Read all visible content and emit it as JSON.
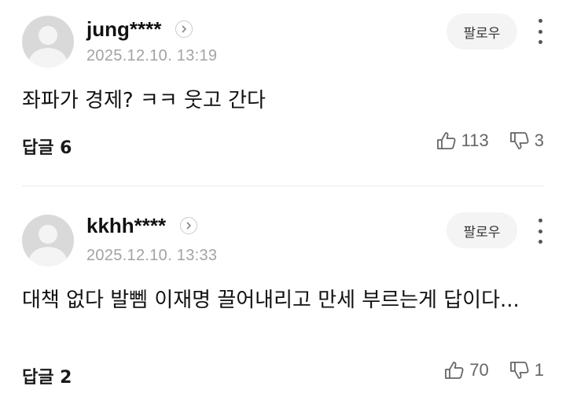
{
  "comments": [
    {
      "username": "jung****",
      "timestamp": "2025.12.10. 13:19",
      "follow_label": "팔로우",
      "text": "좌파가 경제? ㅋㅋ 웃고 간다",
      "reply_label": "답글 6",
      "likes": "113",
      "dislikes": "3"
    },
    {
      "username": "kkhh****",
      "timestamp": "2025.12.10. 13:33",
      "follow_label": "팔로우",
      "text": "대책 없다 발뻼 이재명 끌어내리고 만세 부르는게 답이다...",
      "reply_label": "답글 2",
      "likes": "70",
      "dislikes": "1"
    }
  ],
  "icons": {
    "chevron": "chevron-right-icon",
    "like": "thumbs-up-icon",
    "dislike": "thumbs-down-icon",
    "more": "more-vertical-icon"
  }
}
